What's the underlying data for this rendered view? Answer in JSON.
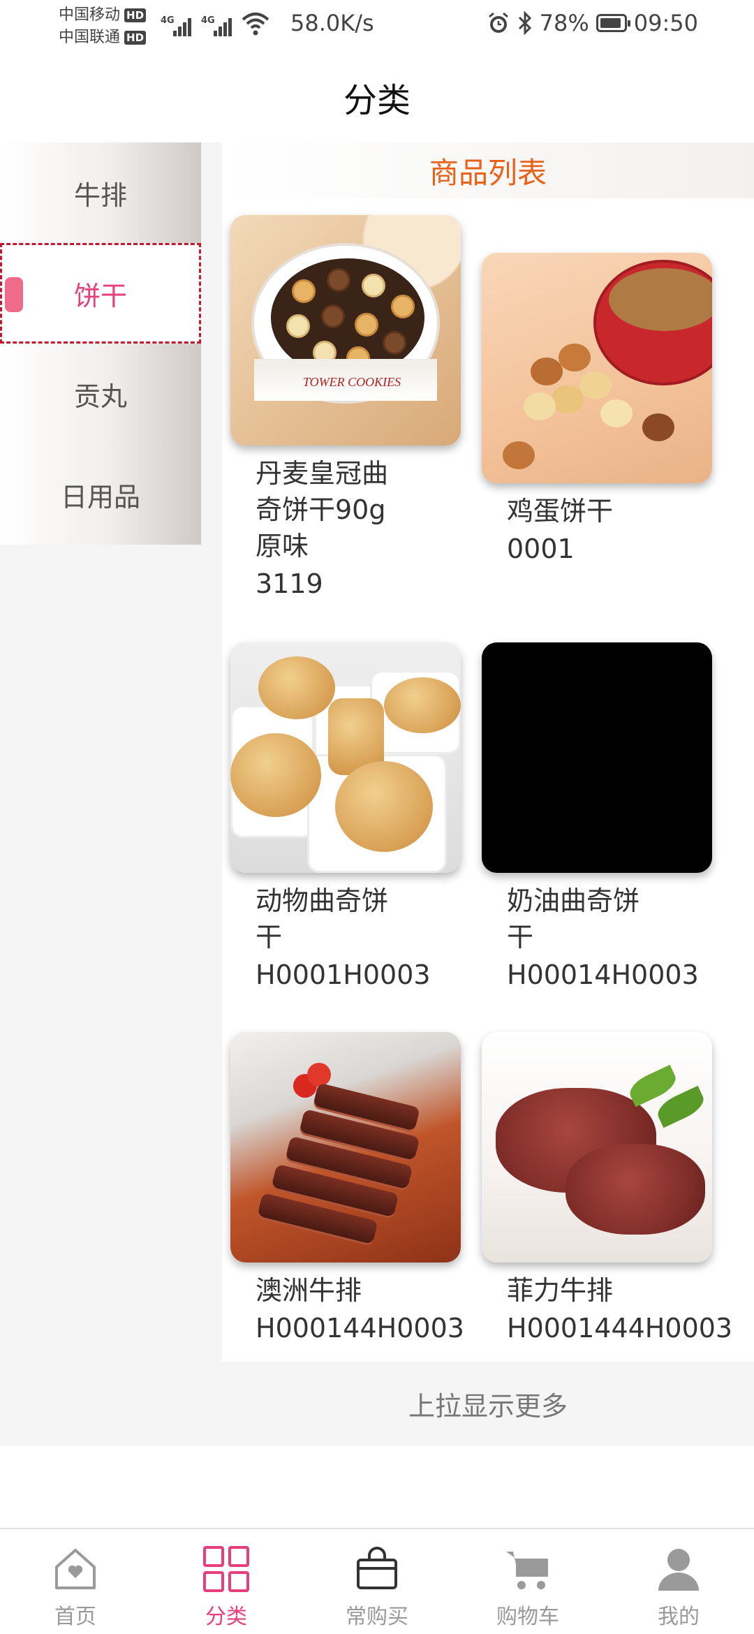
{
  "status_bar": {
    "carrier1": "中国移动",
    "carrier2": "中国联通",
    "hd": "HD",
    "net1": "4G",
    "net2": "4G",
    "speed": "58.0K/s",
    "battery_percent": "78%",
    "battery_level": 0.78,
    "time": "09:50"
  },
  "header": {
    "title": "分类"
  },
  "sidebar": {
    "items": [
      {
        "label": "牛排",
        "active": false
      },
      {
        "label": "饼干",
        "active": true
      },
      {
        "label": "贡丸",
        "active": false
      },
      {
        "label": "日用品",
        "active": false
      }
    ]
  },
  "main": {
    "list_title": "商品列表",
    "products": [
      {
        "name": "丹麦皇冠曲奇饼干90g 原味",
        "price": "3119",
        "image": "cookie-tin-photo"
      },
      {
        "name": "鸡蛋饼干",
        "price": "0001",
        "image": "egg-cookie-photo"
      },
      {
        "name": "动物曲奇饼干",
        "price": "H0001H0003",
        "image": "butter-biscuit-photo"
      },
      {
        "name": "奶油曲奇饼干",
        "price": "H00014H0003",
        "image": "black-image"
      },
      {
        "name": "澳洲牛排",
        "price": "H000144H0003",
        "image": "sliced-steak-photo"
      },
      {
        "name": "菲力牛排",
        "price": "H0001444H0003",
        "image": "fillet-steak-photo"
      }
    ],
    "tin_brand_text": "TOWER COOKIES",
    "load_more": "上拉显示更多"
  },
  "tabbar": {
    "tabs": [
      {
        "label": "首页",
        "icon": "home-heart-icon",
        "active": false
      },
      {
        "label": "分类",
        "icon": "grid-icon",
        "active": true
      },
      {
        "label": "常购买",
        "icon": "shopping-bag-icon",
        "active": false
      },
      {
        "label": "购物车",
        "icon": "cart-icon",
        "active": false
      },
      {
        "label": "我的",
        "icon": "user-icon",
        "active": false
      }
    ]
  },
  "colors": {
    "accent": "#e83e7a",
    "list_title": "#e8621a",
    "active_border": "#c0182f"
  }
}
